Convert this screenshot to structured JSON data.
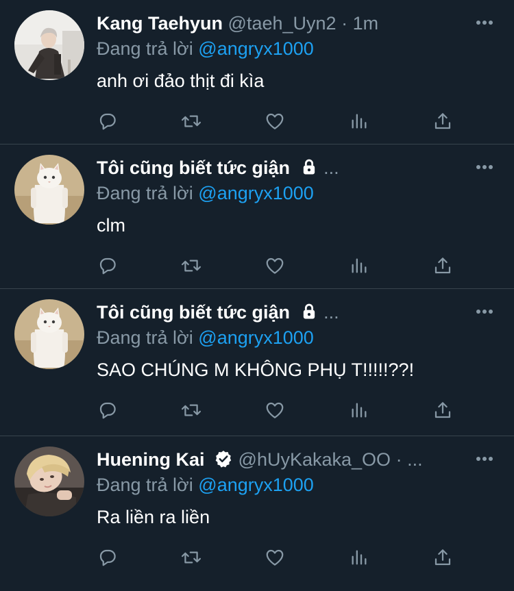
{
  "replies": [
    {
      "display_name": "Kang Taehyun",
      "handle": "@taeh_Uyn2",
      "separator": "·",
      "time": "1m",
      "ellipsis": "",
      "badge": "none",
      "reply_prefix": "Đang trả lời",
      "reply_to": "@angryx1000",
      "text": "anh ơi đảo thịt đi kìa",
      "avatar": "person-in-dark-coat"
    },
    {
      "display_name": "Tôi cũng biết tức giận",
      "handle": "",
      "separator": "",
      "time": "",
      "ellipsis": "...",
      "badge": "lock-icon",
      "reply_prefix": "Đang trả lời",
      "reply_to": "@angryx1000",
      "text": "clm",
      "avatar": "standing-white-cat"
    },
    {
      "display_name": "Tôi cũng biết tức giận",
      "handle": "",
      "separator": "",
      "time": "",
      "ellipsis": "...",
      "badge": "lock-icon",
      "reply_prefix": "Đang trả lời",
      "reply_to": "@angryx1000",
      "text": "SAO CHÚNG M KHÔNG PHỤ T!!!!!??!",
      "avatar": "standing-white-cat"
    },
    {
      "display_name": "Huening Kai",
      "handle": "@hUyKakaka_OO",
      "separator": "·",
      "time": "",
      "ellipsis": "...",
      "badge": "verified-icon",
      "reply_prefix": "Đang trả lời",
      "reply_to": "@angryx1000",
      "text": "Ra liền ra liền",
      "avatar": "blonde-person-lying-down"
    }
  ],
  "icons": {
    "more": "more-horizontal-icon",
    "reply": "reply-icon",
    "retweet": "retweet-icon",
    "like": "like-icon",
    "analytics": "analytics-icon",
    "share": "share-icon"
  },
  "colors": {
    "background": "#15202b",
    "divider": "#38444d",
    "text_primary": "#ffffff",
    "text_secondary": "#8899a6",
    "link": "#1da1f2"
  }
}
